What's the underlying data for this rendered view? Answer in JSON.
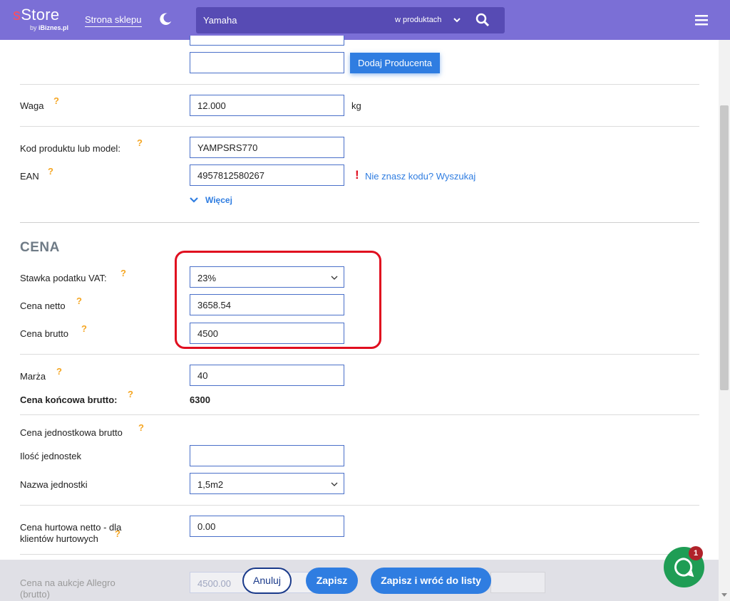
{
  "header": {
    "logo_s": "s",
    "logo_rest": "Store",
    "logo_by": "by ",
    "logo_brand": "iBiznes.pl",
    "shop_link": "Strona sklepu",
    "search_value": "Yamaha",
    "search_scope": "w produktach"
  },
  "producer": {
    "add_button": "Dodaj Producenta"
  },
  "weight": {
    "label": "Waga",
    "value": "12.000",
    "unit": "kg"
  },
  "codes": {
    "model_label": "Kod produktu lub model:",
    "model_value": "YAMPSRS770",
    "ean_label": "EAN",
    "ean_value": "4957812580267",
    "ean_warning": "!",
    "ean_link": "Nie znasz kodu? Wyszukaj",
    "more_link": "Więcej"
  },
  "price": {
    "section_title": "CENA",
    "vat_label": "Stawka podatku VAT:",
    "vat_value": "23%",
    "net_label": "Cena netto",
    "net_value": "3658.54",
    "gross_label": "Cena brutto",
    "gross_value": "4500"
  },
  "margin": {
    "label": "Marża",
    "value": "40",
    "final_label": "Cena końcowa brutto:",
    "final_value": "6300"
  },
  "unit_price": {
    "title": "Cena jednostkowa brutto",
    "count_label": "Ilość jednostek",
    "count_value": "",
    "unit_name_label": "Nazwa jednostki",
    "unit_name_value": "1,5m2"
  },
  "wholesale": {
    "label_line1": "Cena hurtowa netto - dla",
    "label_line2": "klientów hurtowych",
    "value": "0.00"
  },
  "allegro": {
    "label_line1": "Cena na aukcje Allegro",
    "label_line2": "(brutto)",
    "value": "4500.00"
  },
  "help_glyph": "?",
  "actions": {
    "cancel": "Anuluj",
    "save": "Zapisz",
    "save_back": "Zapisz i wróć do listy"
  },
  "chat": {
    "badge": "1"
  },
  "colors": {
    "header": "#7b6fd6",
    "accent": "#2f7de1",
    "help": "#f5a623",
    "highlight": "#e00e1f",
    "chat": "#1f9d55"
  }
}
